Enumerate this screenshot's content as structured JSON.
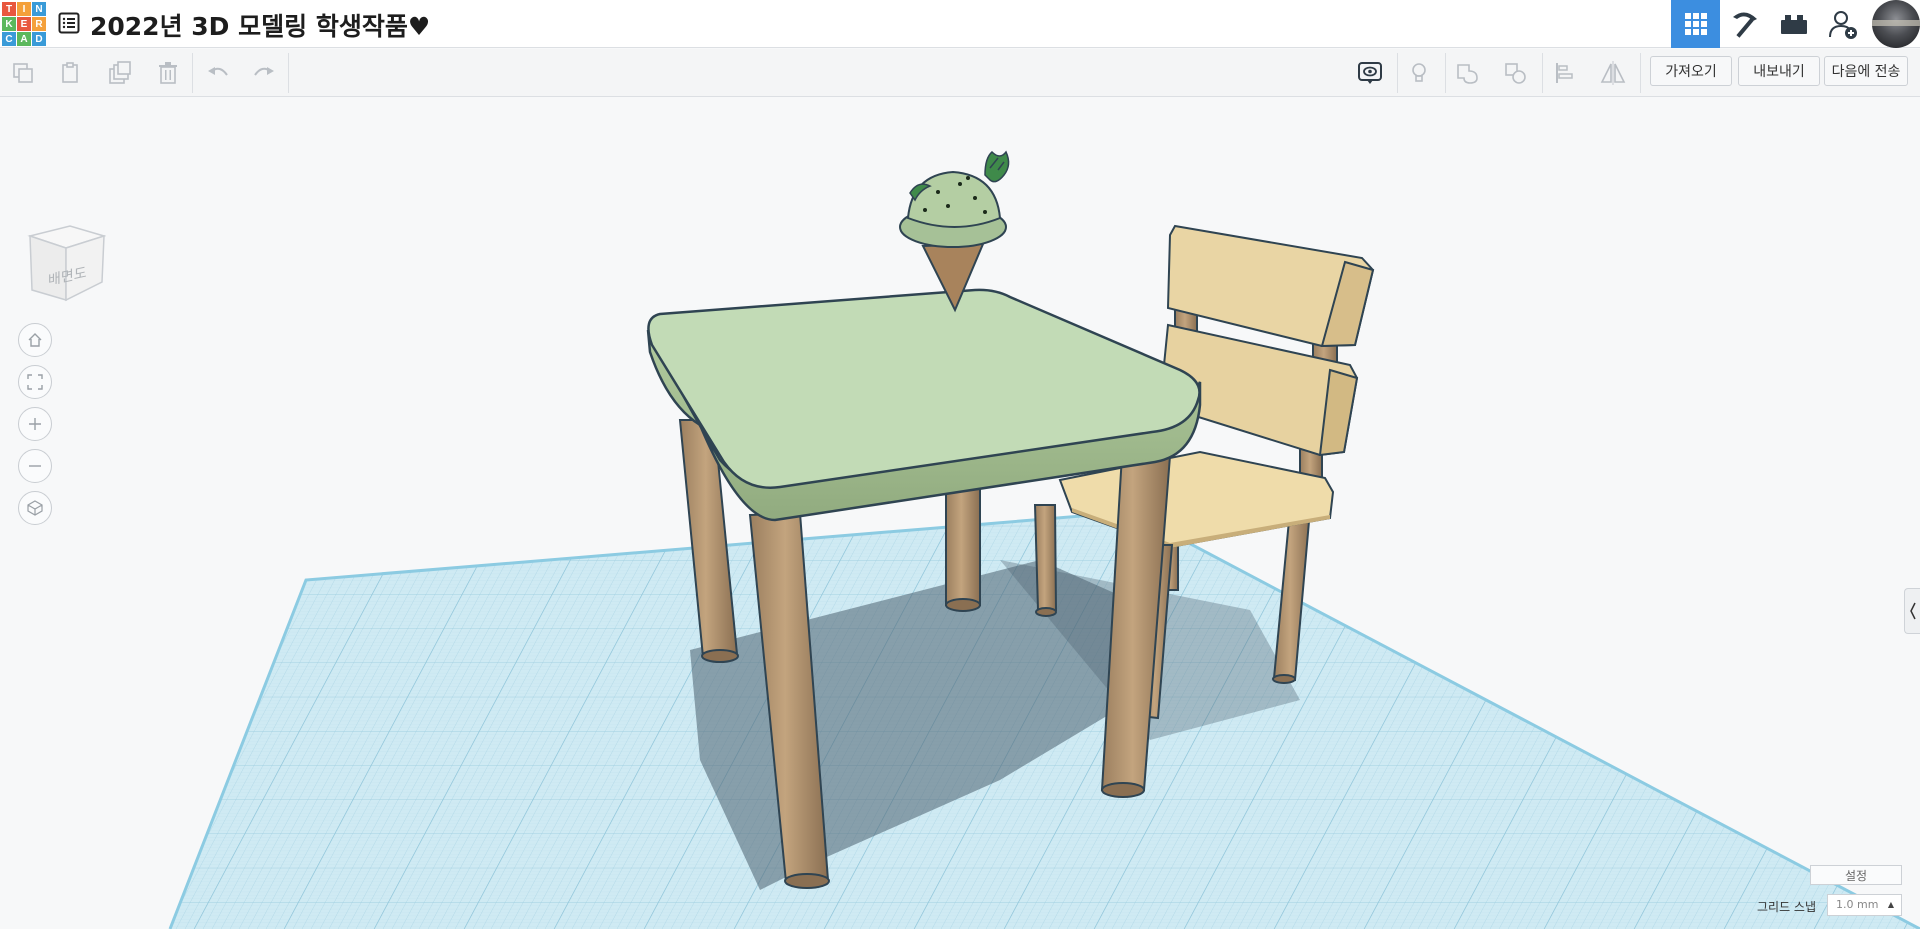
{
  "app": {
    "logo_letters": [
      "T",
      "I",
      "N",
      "K",
      "E",
      "R",
      "C",
      "A",
      "D"
    ],
    "logo_colors": [
      "#e8573e",
      "#f4a03a",
      "#3a9bd8",
      "#5bb85c",
      "#e8573e",
      "#f4a03a",
      "#3a9bd8",
      "#5bb85c",
      "#3a9bd8"
    ]
  },
  "header": {
    "title": "2022년 3D 모델링 학생작품♥",
    "buttons": [
      {
        "name": "3d-design-view",
        "icon": "grid-icon",
        "active": true
      },
      {
        "name": "blocks-pickaxe-view",
        "icon": "pickaxe-icon"
      },
      {
        "name": "bricks-view",
        "icon": "brick-icon"
      },
      {
        "name": "add-user",
        "icon": "add-user-icon"
      }
    ],
    "accent": "#3c8ee0"
  },
  "toolbar": {
    "import_label": "가져오기",
    "export_label": "내보내기",
    "send_to_label": "다음에 전송"
  },
  "viewport": {
    "view_cube_label": "배면도",
    "settings_label": "설정",
    "grid_snap_label": "그리드 스냅",
    "grid_snap_value": "1.0 mm",
    "workplane_color": "#bfe3ef",
    "table_color": "#bfd9b3",
    "chair_color": "#e7d2a0",
    "leg_color": "#b89a74"
  }
}
